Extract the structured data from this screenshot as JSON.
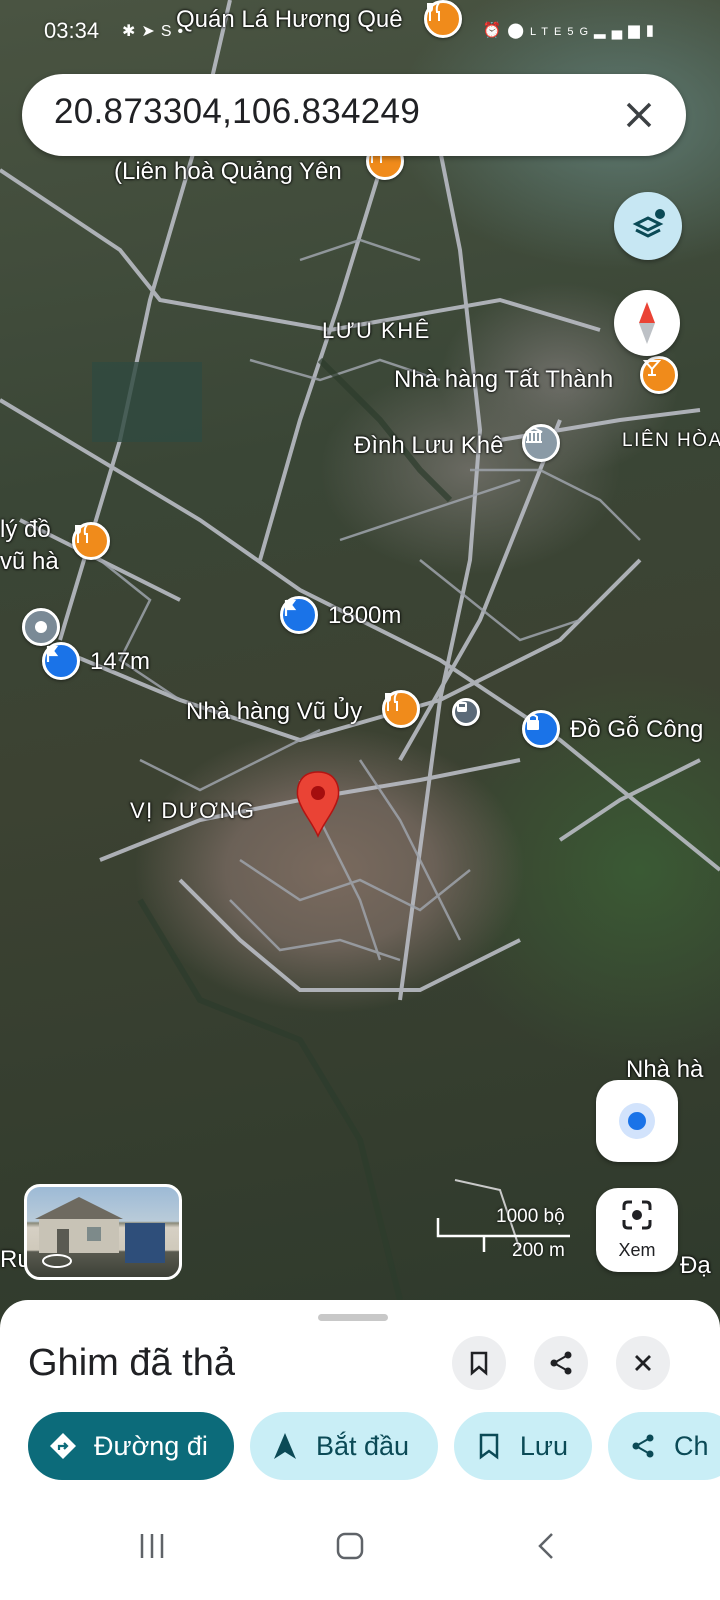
{
  "status_bar": {
    "time": "03:34",
    "network": "5G",
    "lte": "LTE"
  },
  "search": {
    "query": "20.873304,106.834249"
  },
  "map": {
    "labels": {
      "quan_la": "Quán Lá Hương Quê",
      "lien_hoa": "(Liên hoà Quảng Yên",
      "luu_khe": "LƯU KHÊ",
      "tat_thanh": "Nhà hàng Tất Thành",
      "dinh_luu_khe": "Đình Lưu Khê",
      "lien_hoa_right": "LIÊN HÒA",
      "ly_do": "lý đồ",
      "vu_ha": "vũ hà",
      "parking_1800": "1800m",
      "parking_147": "147m",
      "vu_uy": "Nhà hàng Vũ Ủy",
      "do_go": "Đồ Gỗ Công",
      "vi_duong": "VỊ DƯƠNG",
      "nha_ha": "Nhà hà",
      "ru": "Ru",
      "da": "Đạ"
    },
    "scale": {
      "imperial": "1000 bộ",
      "metric": "200 m"
    },
    "xem_label": "Xem"
  },
  "sheet": {
    "title": "Ghim đã thả",
    "chips": {
      "directions": "Đường đi",
      "start": "Bắt đầu",
      "save": "Lưu",
      "share": "Ch"
    }
  }
}
